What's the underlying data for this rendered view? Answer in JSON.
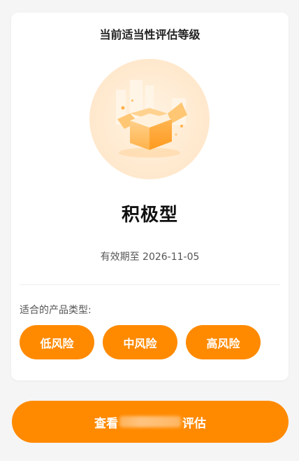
{
  "card": {
    "title": "当前适当性评估等级",
    "level": "积极型",
    "validity": "有效期至 2026-11-05",
    "products_label": "适合的产品类型:",
    "tags": [
      "低风险",
      "中风险",
      "高风险"
    ]
  },
  "cta": {
    "prefix": "查看",
    "suffix": "评估"
  },
  "colors": {
    "accent": "#ff8a00",
    "background": "#f5f5f5",
    "card": "#ffffff"
  },
  "icons": {
    "illustration": "open-box-illustration"
  }
}
